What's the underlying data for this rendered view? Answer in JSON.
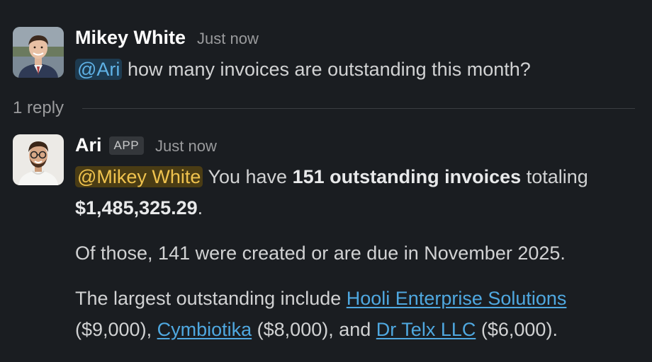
{
  "messages": [
    {
      "sender": "Mikey White",
      "timestamp": "Just now",
      "mention": "@Ari",
      "text": "how many invoices are outstanding this month?"
    },
    {
      "sender": "Ari",
      "badge": "APP",
      "timestamp": "Just now",
      "mention": "@Mikey White",
      "p1_pre": "You have",
      "p1_bold": "151 outstanding invoices",
      "p1_mid": "totaling",
      "p1_amount": "$1,485,325.29",
      "p1_end": ".",
      "p2": "Of those, 141 were created or are due in November 2025.",
      "p3_pre": "The largest outstanding include",
      "link1": "Hooli Enterprise Solutions",
      "amt1": "($9,000),",
      "link2": "Cymbiotika",
      "amt2": "($8,000), and",
      "link3": "Dr Telx LLC",
      "amt3": "($6,000)."
    }
  ],
  "thread": {
    "reply_count": "1 reply"
  },
  "colors": {
    "background": "#1a1d21",
    "mention_user": "#f0c34e",
    "mention_app": "#5fb2e6",
    "link": "#4fa8e0"
  }
}
